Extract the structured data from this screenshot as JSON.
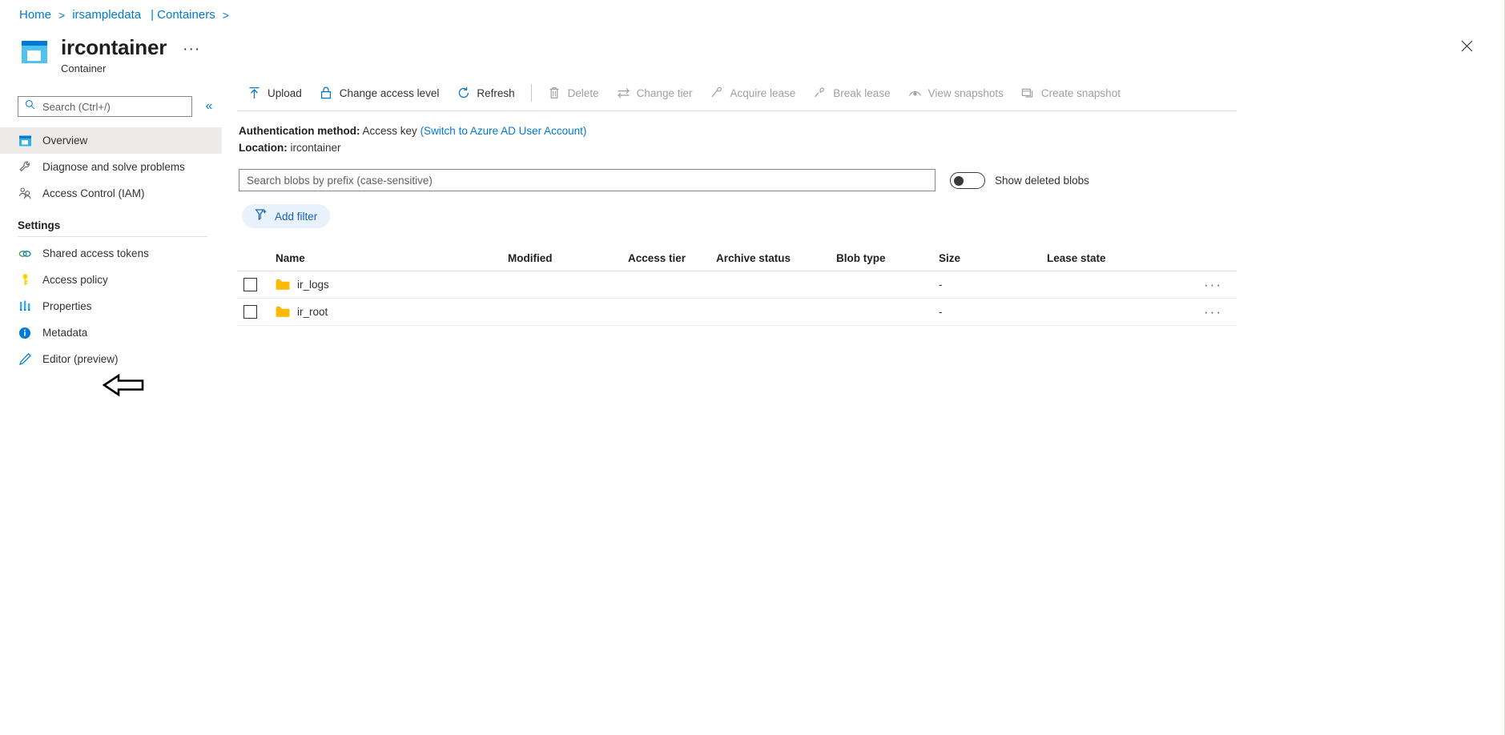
{
  "breadcrumb": {
    "home": "Home",
    "account": "irsampledata",
    "section": "| Containers"
  },
  "header": {
    "title": "ircontainer",
    "subtitle": "Container",
    "ellipsis": "···",
    "close_icon": "close-icon"
  },
  "sidebar": {
    "search_placeholder": "Search (Ctrl+/)",
    "collapse_label": "«",
    "items": [
      {
        "label": "Overview",
        "icon": "overview-icon",
        "active": true
      },
      {
        "label": "Diagnose and solve problems",
        "icon": "wrench-icon",
        "active": false
      },
      {
        "label": "Access Control (IAM)",
        "icon": "people-icon",
        "active": false
      }
    ],
    "settings_group": "Settings",
    "settings_items": [
      {
        "label": "Shared access tokens",
        "icon": "link-icon"
      },
      {
        "label": "Access policy",
        "icon": "key-icon"
      },
      {
        "label": "Properties",
        "icon": "properties-icon"
      },
      {
        "label": "Metadata",
        "icon": "info-icon"
      },
      {
        "label": "Editor (preview)",
        "icon": "pencil-icon"
      }
    ],
    "annotation": "arrow-pointing-to-properties"
  },
  "toolbar": {
    "commands": [
      {
        "label": "Upload",
        "icon": "upload-icon",
        "disabled": false
      },
      {
        "label": "Change access level",
        "icon": "lock-icon",
        "disabled": false
      },
      {
        "label": "Refresh",
        "icon": "refresh-icon",
        "disabled": false
      },
      {
        "label": "Delete",
        "icon": "trash-icon",
        "disabled": true
      },
      {
        "label": "Change tier",
        "icon": "swap-icon",
        "disabled": true
      },
      {
        "label": "Acquire lease",
        "icon": "lease-icon",
        "disabled": true
      },
      {
        "label": "Break lease",
        "icon": "break-lease-icon",
        "disabled": true
      },
      {
        "label": "View snapshots",
        "icon": "snapshot-view-icon",
        "disabled": true
      },
      {
        "label": "Create snapshot",
        "icon": "snapshot-create-icon",
        "disabled": true
      }
    ]
  },
  "info": {
    "auth_label": "Authentication method:",
    "auth_value": "Access key",
    "auth_link": "(Switch to Azure AD User Account)",
    "location_label": "Location:",
    "location_value": "ircontainer"
  },
  "filters": {
    "blob_search_placeholder": "Search blobs by prefix (case-sensitive)",
    "blob_search_value": "",
    "show_deleted_label": "Show deleted blobs",
    "show_deleted_on": false,
    "add_filter_label": "Add filter"
  },
  "table": {
    "columns": [
      "Name",
      "Modified",
      "Access tier",
      "Archive status",
      "Blob type",
      "Size",
      "Lease state"
    ],
    "rows": [
      {
        "name": "ir_logs",
        "icon": "folder-icon",
        "modified": "",
        "access_tier": "",
        "archive_status": "",
        "blob_type": "",
        "size": "-",
        "lease_state": "",
        "more": "···"
      },
      {
        "name": "ir_root",
        "icon": "folder-icon",
        "modified": "",
        "access_tier": "",
        "archive_status": "",
        "blob_type": "",
        "size": "-",
        "lease_state": "",
        "more": "···"
      }
    ]
  },
  "colors": {
    "accent": "#0078d4",
    "link": "#0078d4",
    "folder": "#ffb900",
    "disabled": "#a19f9d",
    "selected_row_bg": "#edebe9"
  }
}
